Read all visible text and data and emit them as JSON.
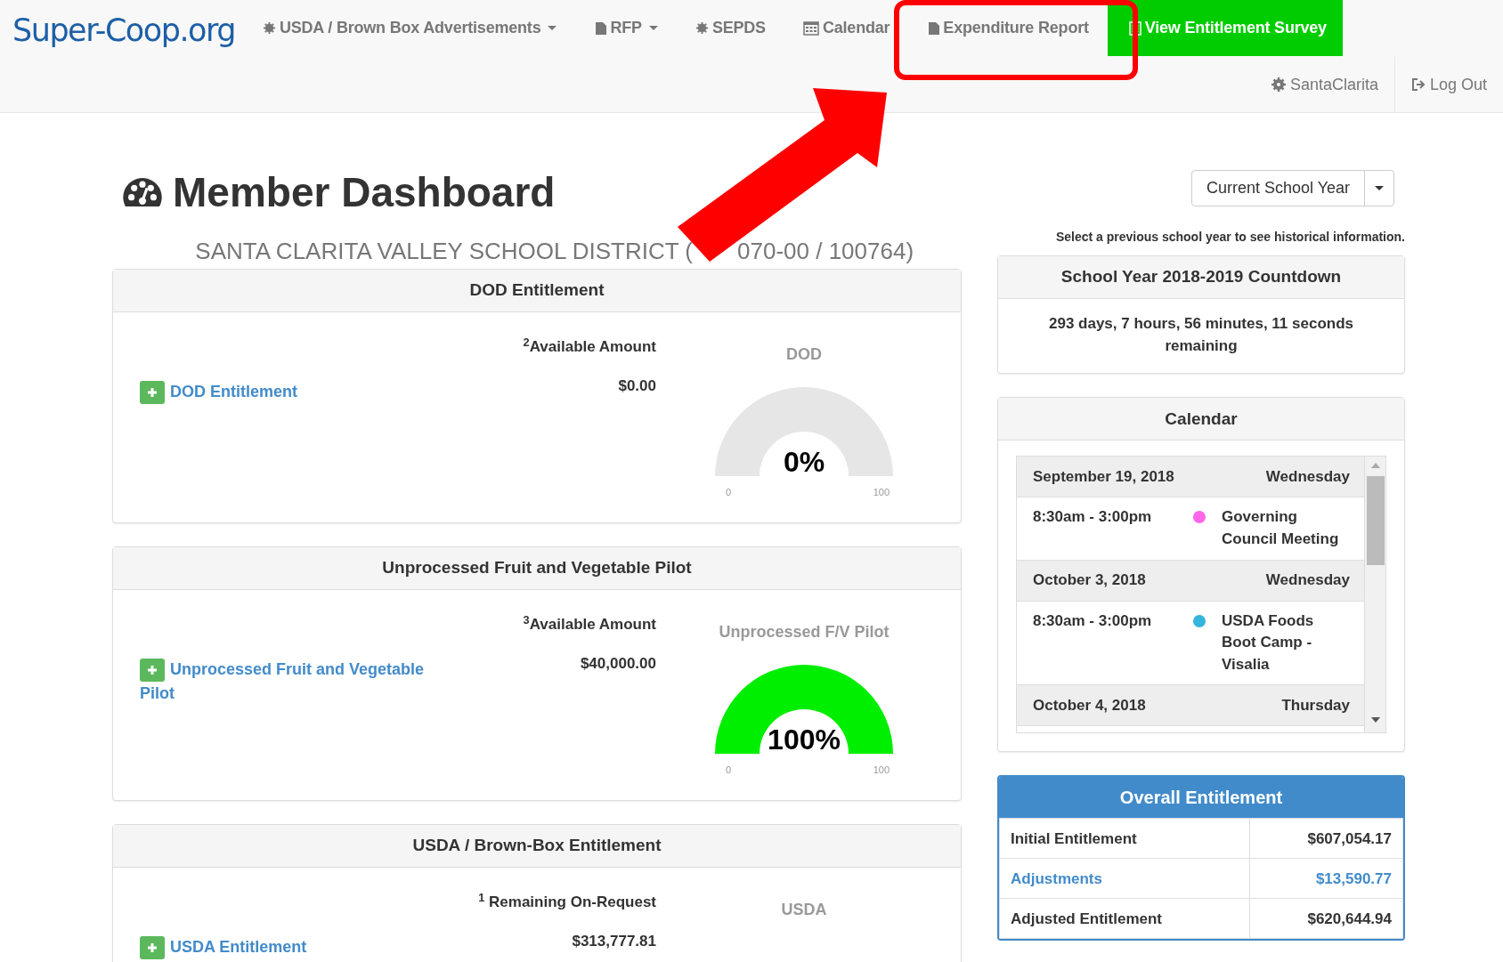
{
  "nav": {
    "logo": "Super-Coop.org",
    "items": [
      {
        "label": "USDA / Brown Box Advertisements",
        "dropdown": true,
        "highlighted": false
      },
      {
        "label": "RFP",
        "dropdown": true,
        "highlighted": false
      },
      {
        "label": "SEPDS",
        "dropdown": false,
        "highlighted": false
      },
      {
        "label": "Calendar",
        "dropdown": false,
        "highlighted": false
      },
      {
        "label": "Expenditure Report",
        "dropdown": false,
        "highlighted": false
      },
      {
        "label": "View Entitlement Survey",
        "dropdown": false,
        "highlighted": true
      }
    ],
    "user_items": [
      {
        "label": "SantaClarita"
      },
      {
        "label": "Log Out"
      }
    ]
  },
  "title": "Member Dashboard",
  "district": {
    "before_arrow": "SANTA CLARITA VALLEY SCHOOL DISTRICT (",
    "after_arrow": "070-00 / 100764)"
  },
  "cards": [
    {
      "title": "DOD Entitlement",
      "amount_label": "$^{2}$Available Amount",
      "link": "DOD Entitlement",
      "amount": "$0.00",
      "gauge": {
        "label": "DOD",
        "value": "0%",
        "level": 0,
        "min": "0",
        "max": "100"
      }
    },
    {
      "title": "Unprocessed Fruit and Vegetable Pilot",
      "amount_label": "$^{3}$Available Amount",
      "link": "Unprocessed Fruit and Vegetable Pilot",
      "amount": "$40,000.00",
      "gauge": {
        "label": "Unprocessed F/V Pilot",
        "value": "100%",
        "level": 1,
        "min": "0",
        "max": "100"
      }
    },
    {
      "title": "USDA / Brown-Box Entitlement",
      "amount_label": "$^{1}$ Remaining On-Request",
      "link": "USDA Entitlement",
      "amount": "$313,777.81",
      "gauge": {
        "label": "USDA"
      }
    }
  ],
  "year_select": {
    "value": "Current School Year",
    "hint": "Select a previous school year to see historical information."
  },
  "countdown": {
    "title": "School Year 2018-2019 Countdown",
    "text": "293 days, 7 hours, 56 minutes, 11 seconds remaining"
  },
  "calendar": {
    "title": "Calendar",
    "days": [
      {
        "date": "September 19, 2018",
        "weekday": "Wednesday",
        "events": [
          {
            "time": "8:30am - 3:00pm",
            "title": "Governing Council Meeting",
            "color": "#ff66e8"
          }
        ]
      },
      {
        "date": "October 3, 2018",
        "weekday": "Wednesday",
        "events": [
          {
            "time": "8:30am - 3:00pm",
            "title": "USDA Foods Boot Camp - Visalia",
            "color": "#33b5dd"
          }
        ]
      },
      {
        "date": "October 4, 2018",
        "weekday": "Thursday"
      }
    ]
  },
  "overall": {
    "title": "Overall Entitlement",
    "rows": [
      {
        "label": "Initial Entitlement",
        "value": "$607,054.17",
        "kind": "text"
      },
      {
        "label": "Adjustments",
        "value": "$13,590.77",
        "kind": "link"
      },
      {
        "label": "Adjusted Entitlement",
        "value": "$620,644.94",
        "kind": "text"
      }
    ]
  }
}
